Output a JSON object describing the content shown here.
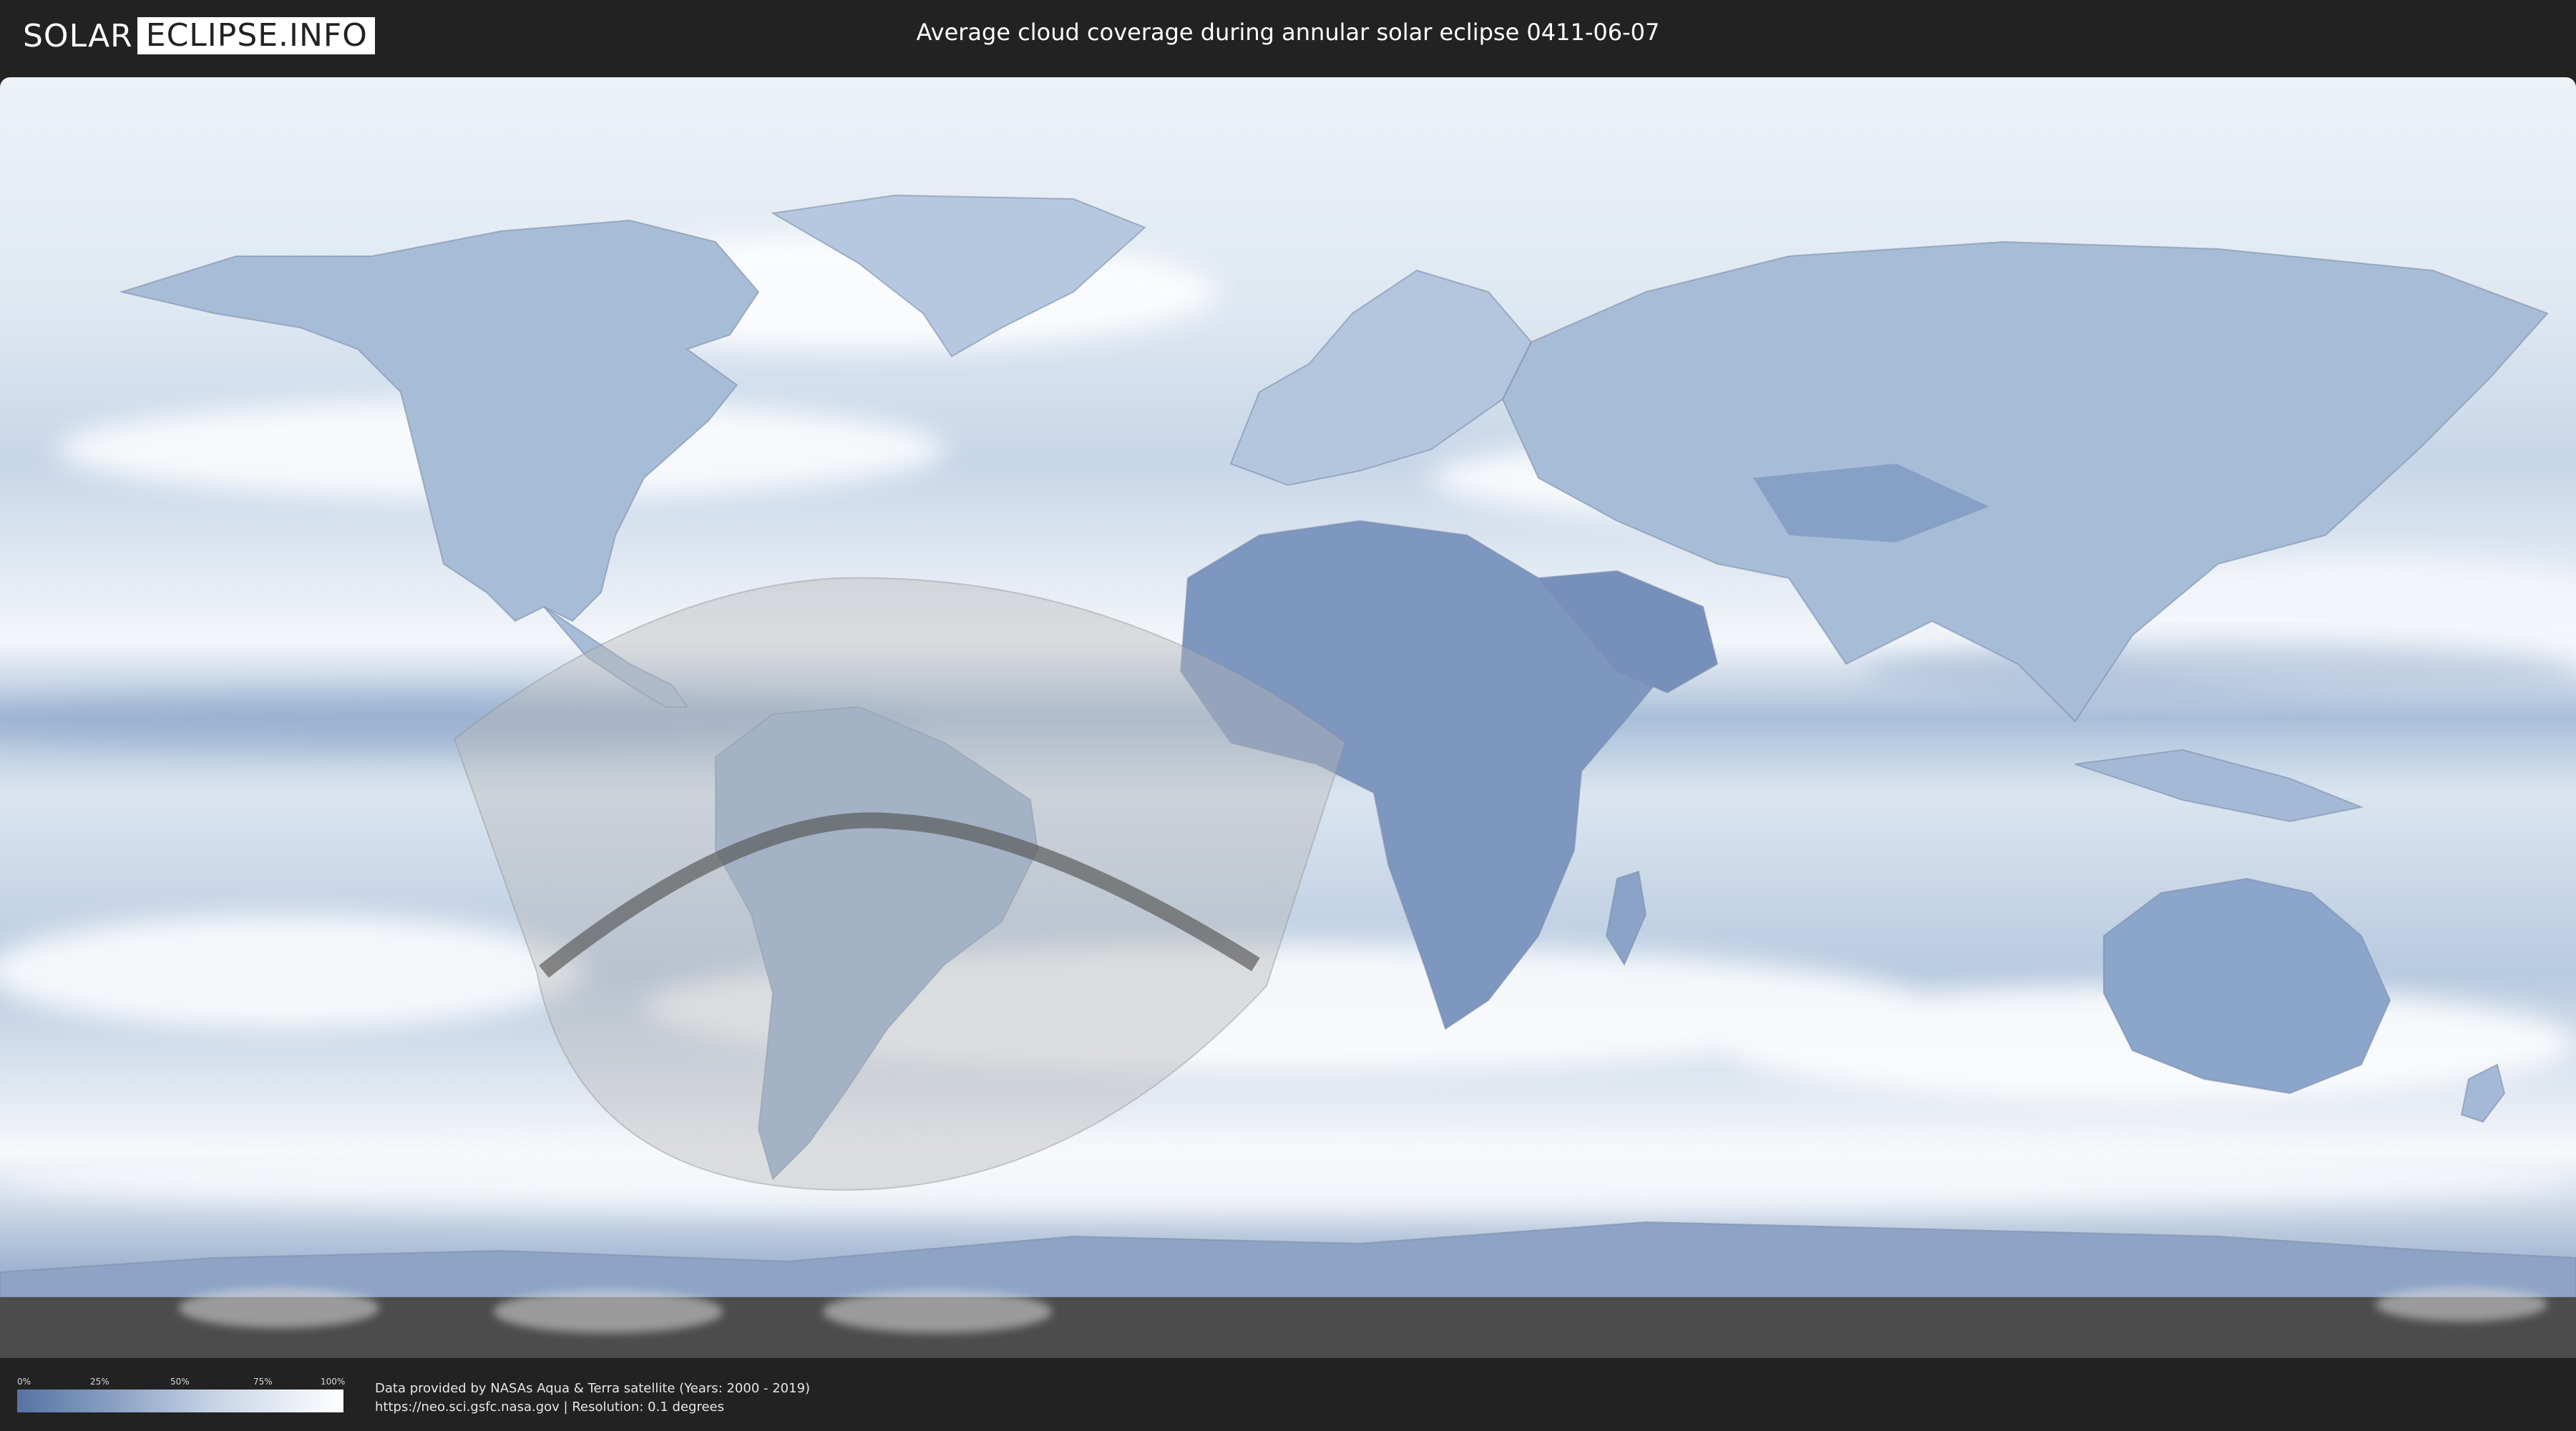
{
  "header": {
    "logo_part1": "SOLAR",
    "logo_part2": "ECLIPSE.INFO",
    "title": "Average cloud coverage during annular solar eclipse 0411-06-07"
  },
  "map": {
    "layer": "average cloud coverage",
    "colors": {
      "clear_sky": "#5673a3",
      "cloudy": "#ffffff",
      "ocean_cloud_base": "#eaf1f8",
      "visibility_zone_fill": "#b8b8b8",
      "central_path": "#555555",
      "no_data_band": "#4c4c4c"
    },
    "eclipse": {
      "type": "annular",
      "date": "0411-06-07"
    }
  },
  "legend": {
    "ticks": [
      "0%",
      "25%",
      "50%",
      "75%",
      "100%"
    ],
    "gradient_start": "#5673a3",
    "gradient_end": "#ffffff"
  },
  "footer": {
    "credit_line1": "Data provided by NASAs Aqua & Terra satellite (Years: 2000 - 2019)",
    "credit_line2": "https://neo.sci.gsfc.nasa.gov | Resolution: 0.1 degrees"
  }
}
